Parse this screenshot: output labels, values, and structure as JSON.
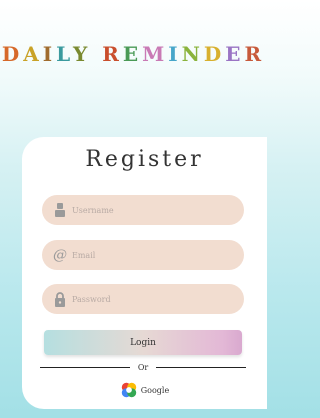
{
  "app": {
    "title_letters": [
      {
        "char": "D",
        "color": "#d6692a"
      },
      {
        "char": "A",
        "color": "#c9a227"
      },
      {
        "char": "I",
        "color": "#a06c2e"
      },
      {
        "char": "L",
        "color": "#3a9a9e"
      },
      {
        "char": "Y",
        "color": "#7a8a30"
      },
      {
        "char": " ",
        "color": "#000000"
      },
      {
        "char": "R",
        "color": "#c94e2c"
      },
      {
        "char": "E",
        "color": "#4a9a56"
      },
      {
        "char": "M",
        "color": "#c97ab5"
      },
      {
        "char": "I",
        "color": "#46a6c9"
      },
      {
        "char": "N",
        "color": "#8ab33c"
      },
      {
        "char": "D",
        "color": "#d8b02e"
      },
      {
        "char": "E",
        "color": "#9a74c4"
      },
      {
        "char": "R",
        "color": "#c75a3b"
      }
    ]
  },
  "register": {
    "title": "Register",
    "username": {
      "placeholder": "Username",
      "icon": "user-icon"
    },
    "email": {
      "placeholder": "Email",
      "icon": "at-icon"
    },
    "password": {
      "placeholder": "Password",
      "icon": "lock-icon"
    },
    "login_label": "Login",
    "divider_text": "Or",
    "google_label": "Google"
  }
}
